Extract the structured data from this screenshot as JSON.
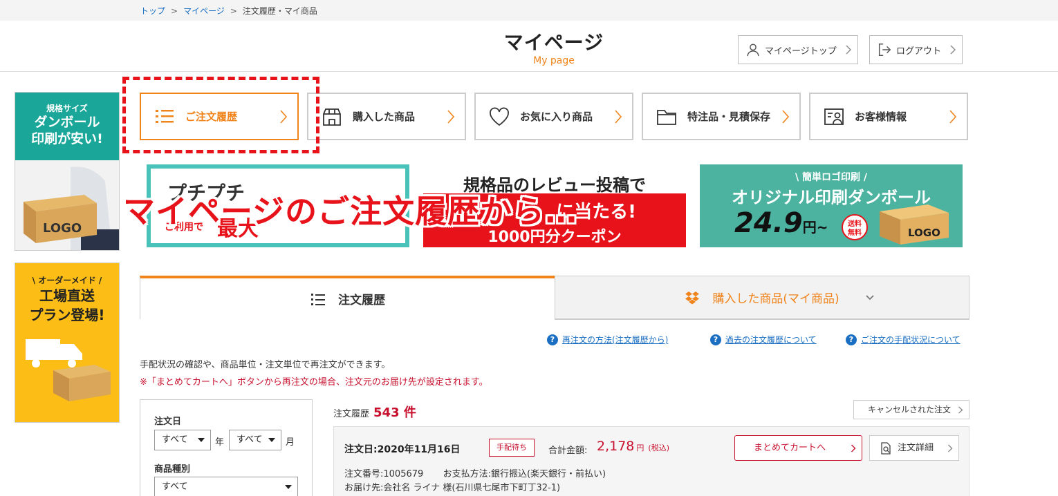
{
  "breadcrumb": {
    "top": "トップ",
    "mypage": "マイページ",
    "current": "注文履歴・マイ商品",
    "sep": ">"
  },
  "header": {
    "title": "マイページ",
    "subtitle": "My page",
    "mypage_top": "マイページトップ",
    "logout": "ログアウト"
  },
  "side_banners": {
    "b1_l1": "規格サイズ",
    "b1_l2": "ダンボール",
    "b1_l3": "印刷が安い!",
    "b1_logo": "LOGO",
    "b2_l1": "\\ オーダーメイド /",
    "b2_l2": "工場直送",
    "b2_l3": "プラン登場!"
  },
  "nav": {
    "orders": "ご注文履歴",
    "purchased": "購入した商品",
    "favorites": "お気に入り商品",
    "special": "特注品・見積保存",
    "customer": "お客様情報"
  },
  "promos": {
    "p1_title": "プチプチ",
    "p1_note": "ご利用で",
    "p1_big": "最大",
    "p2_title": "規格品のレビュー投稿で",
    "p2_red": "に当たる!",
    "p2_coupon": "1000円分クーポン",
    "p3_top": "\\ 簡単ロゴ印刷 /",
    "p3_title": "オリジナル印刷ダンボール",
    "p3_price": "24.9",
    "p3_unit": "円~",
    "p3_badge1": "送料",
    "p3_badge2": "無料",
    "p3_logo": "LOGO"
  },
  "overlay_caption": "マイページのご注文履歴から…",
  "tabs": {
    "orders": "注文履歴",
    "items": "購入した商品(マイ商品)"
  },
  "help_links": {
    "reorder": "再注文の方法(注文履歴から)",
    "past": "過去の注文履歴について",
    "status": "ご注文の手配状況について",
    "q": "?"
  },
  "description": {
    "line1": "手配状況の確認や、商品単位・注文単位で再注文ができます。",
    "line2": "※「まとめてカートへ」ボタンから再注文の場合、注文元のお届け先が設定されます。"
  },
  "filter": {
    "date_label": "注文日",
    "year_value": "すべて",
    "year_unit": "年",
    "month_value": "すべて",
    "month_unit": "月",
    "type_label": "商品種別",
    "type_value": "すべて"
  },
  "orders": {
    "count_label": "注文履歴",
    "count_value": "543 件",
    "cancelled": "キャンセルされた注文",
    "list": [
      {
        "date": "注文日:2020年11月16日",
        "status": "手配待ち",
        "total_label": "合計金額:",
        "total": "2,178",
        "currency": "円",
        "tax": "(税込)",
        "cart_button": "まとめてカートへ",
        "detail_button": "注文詳細",
        "order_no": "注文番号:1005679",
        "payment": "お支払方法:銀行振込(楽天銀行・前払い)",
        "ship_to": "お届け先:会社名 ライナ 様(石川県七尾市下町丁32-1)"
      }
    ]
  },
  "colors": {
    "accent": "#f08319",
    "red": "#e8121a",
    "link": "#1b6fc2",
    "teal": "#1aa79a"
  }
}
